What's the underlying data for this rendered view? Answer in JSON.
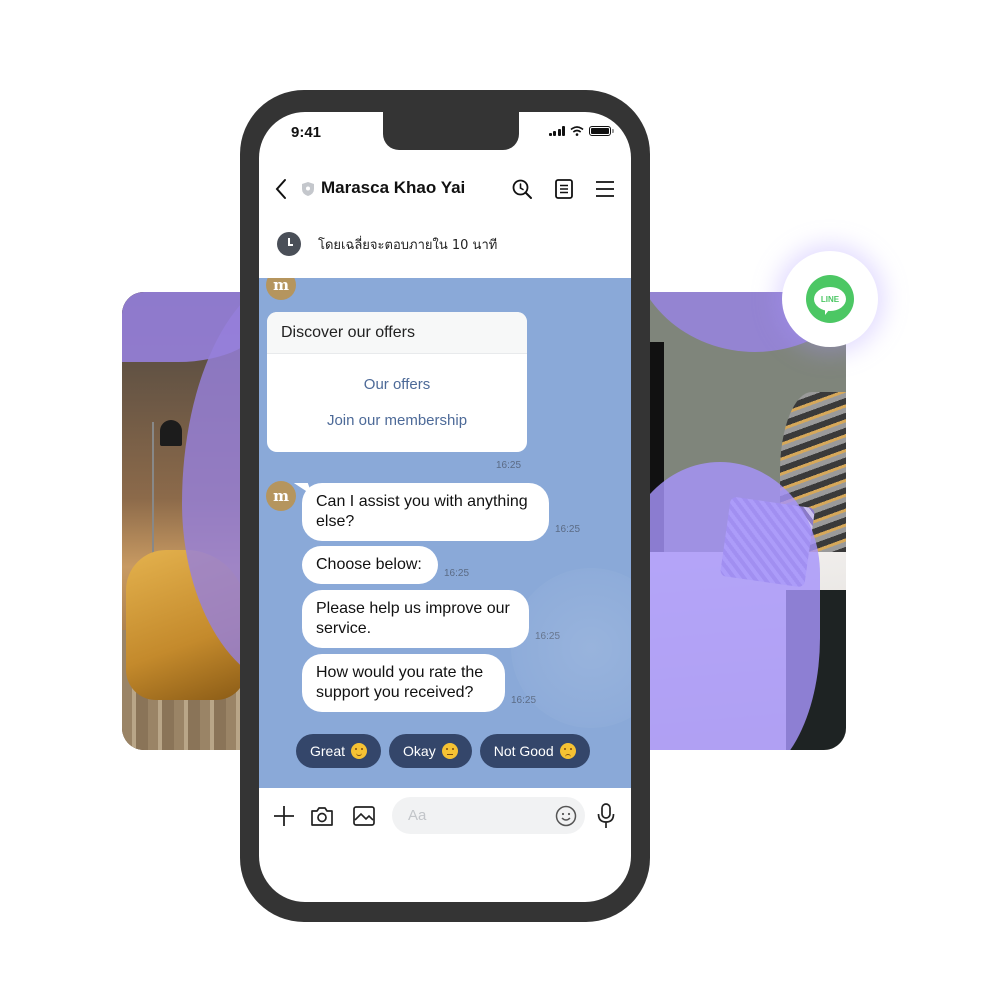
{
  "status_bar": {
    "time": "9:41",
    "icons": [
      "signal-icon",
      "wifi-icon",
      "battery-icon"
    ]
  },
  "header": {
    "back_icon": "chevron-left-icon",
    "verified_icon": "shield-icon",
    "title": "Marasca Khao Yai",
    "actions": [
      "search-icon",
      "notes-icon",
      "menu-icon"
    ]
  },
  "reply_notice": {
    "icon": "clock-icon",
    "text": "โดยเฉลี่ยจะตอบภายใน 10 นาที"
  },
  "avatar_letter": "m",
  "messages": {
    "card": {
      "title": "Discover our offers",
      "links": [
        "Our offers",
        "Join our membership"
      ],
      "time": "16:25"
    },
    "bubbles": [
      {
        "text": "Can I assist you with anything else?",
        "time": "16:25"
      },
      {
        "text": "Choose below:",
        "time": "16:25"
      },
      {
        "text": "Please help us improve our service.",
        "time": "16:25"
      },
      {
        "text": "How would you rate the support you received?",
        "time": "16:25"
      }
    ]
  },
  "quick_replies": [
    {
      "label": "Great",
      "emoji": "smiling-face"
    },
    {
      "label": "Okay",
      "emoji": "neutral-face"
    },
    {
      "label": "Not Good",
      "emoji": "pensive-face"
    }
  ],
  "input_bar": {
    "icons": [
      "plus-icon",
      "camera-icon",
      "image-icon",
      "emoji-icon",
      "microphone-icon"
    ],
    "placeholder": "Aa",
    "value": ""
  },
  "badge": {
    "brand": "LINE",
    "brand_color": "#4cc764"
  },
  "colors": {
    "chat_background": "#8aa9d8",
    "quick_reply_bg": "#34466a",
    "link_color": "#4d6a98",
    "phone_frame": "#343434",
    "avatar_bg": "#b5955e",
    "overlay_purple": "#9684dc"
  }
}
